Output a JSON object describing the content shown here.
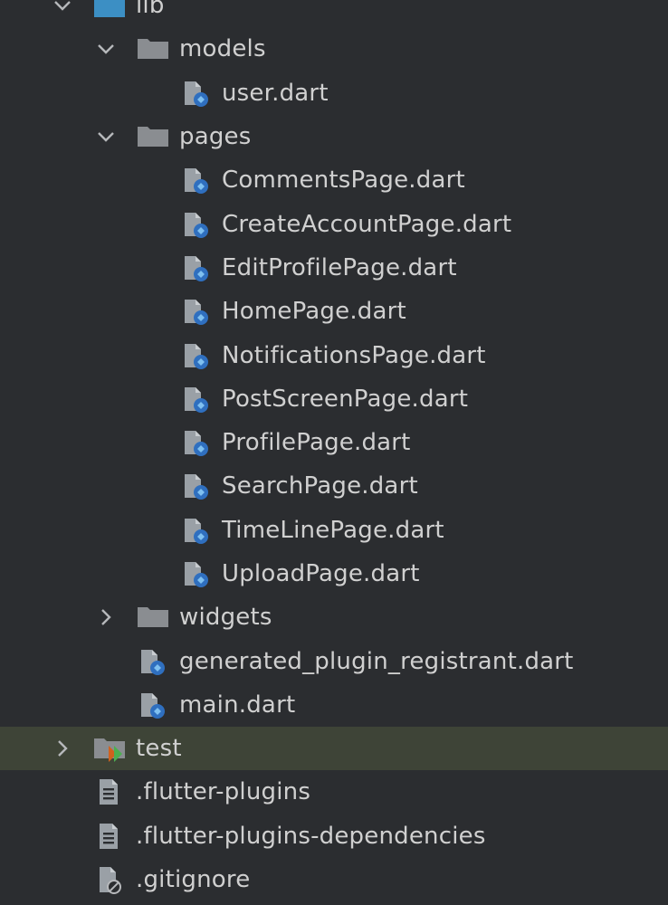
{
  "project_tree": {
    "lib": {
      "label": "lib",
      "expanded": true
    },
    "models": {
      "label": "models",
      "expanded": true,
      "files": [
        {
          "label": "user.dart"
        }
      ]
    },
    "pages": {
      "label": "pages",
      "expanded": true,
      "files": [
        {
          "label": "CommentsPage.dart"
        },
        {
          "label": "CreateAccountPage.dart"
        },
        {
          "label": "EditProfilePage.dart"
        },
        {
          "label": "HomePage.dart"
        },
        {
          "label": "NotificationsPage.dart"
        },
        {
          "label": "PostScreenPage.dart"
        },
        {
          "label": "ProfilePage.dart"
        },
        {
          "label": "SearchPage.dart"
        },
        {
          "label": "TimeLinePage.dart"
        },
        {
          "label": "UploadPage.dart"
        }
      ]
    },
    "widgets": {
      "label": "widgets",
      "expanded": false
    },
    "lib_files": [
      {
        "label": "generated_plugin_registrant.dart"
      },
      {
        "label": "main.dart"
      }
    ],
    "test": {
      "label": "test",
      "expanded": false,
      "selected": true
    },
    "root_files": [
      {
        "label": ".flutter-plugins"
      },
      {
        "label": ".flutter-plugins-dependencies"
      },
      {
        "label": ".gitignore"
      }
    ]
  },
  "colors": {
    "background": "#2b2d30",
    "selected_row": "#3e4437",
    "text": "#d0d0d0",
    "folder": "#8a8d91",
    "source_folder": "#3c8fc4",
    "dart_badge": "#2f6fbf",
    "test_badge": "#d0621e"
  }
}
